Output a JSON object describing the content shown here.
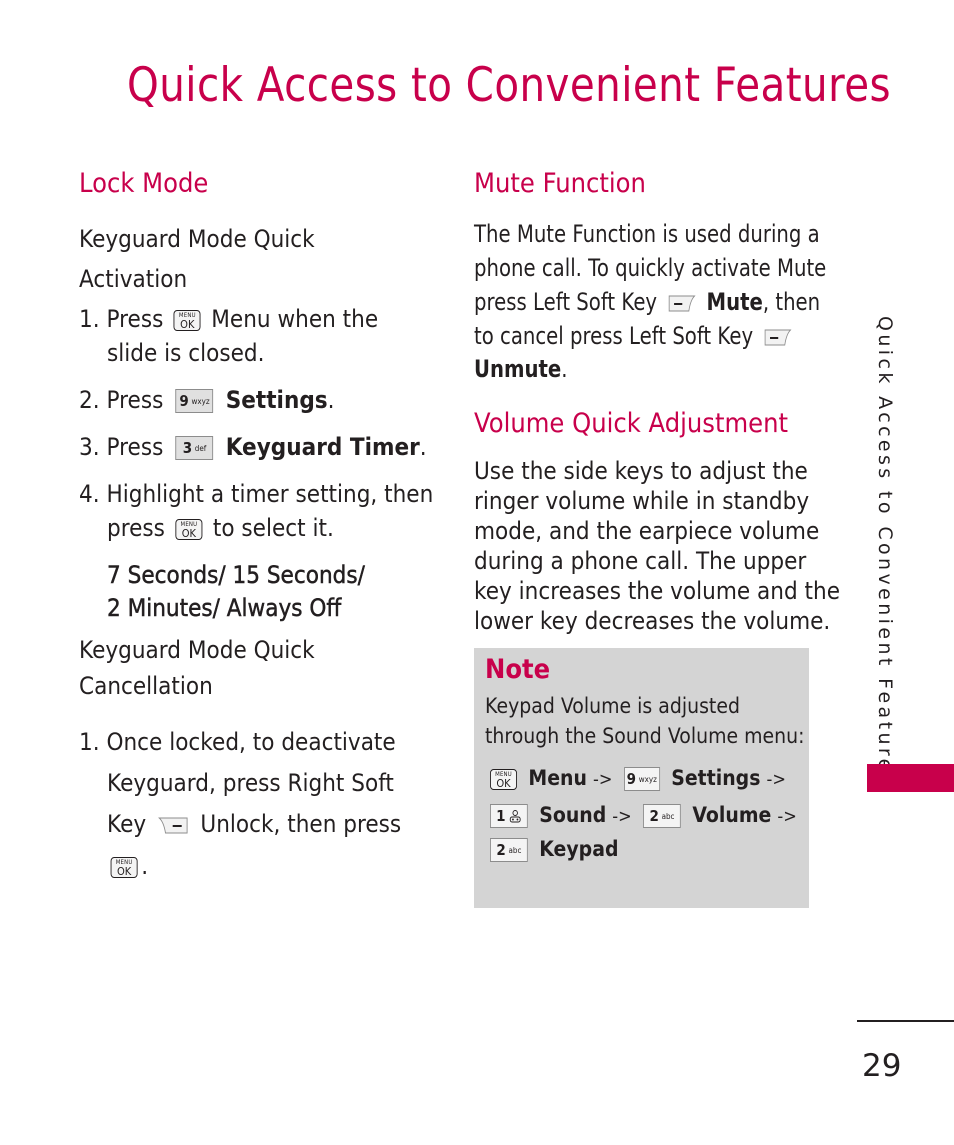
{
  "page": {
    "title": "Quick Access to Convenient Features",
    "side_tab": "Quick Access to Convenient Features",
    "page_number": "29",
    "accent_color": "#c8004b"
  },
  "lock_mode": {
    "heading": "Lock Mode",
    "activation": {
      "heading_line1": "Keyguard Mode Quick",
      "heading_line2": "Activation",
      "steps": [
        {
          "num": "1.",
          "pre": "Press",
          "key": "menu-ok-key",
          "post": "Menu when the",
          "cont": "slide is closed."
        },
        {
          "num": "2.",
          "pre": "Press",
          "key": "9 wxyz",
          "key_num": "9",
          "key_letters": "wxyz",
          "post": "Settings",
          "post_tail": "."
        },
        {
          "num": "3.",
          "pre": "Press",
          "key": "3 def",
          "key_num": "3",
          "key_letters": "def",
          "post": "Keyguard Timer",
          "post_tail": "."
        },
        {
          "num": "4.",
          "line1": "Highlight a timer setting, then",
          "pre": "press",
          "key": "menu-ok-key",
          "post": "to select it."
        }
      ],
      "options_line1": "7 Seconds/ 15 Seconds/",
      "options_line2": "2 Minutes/ Always Off"
    },
    "cancellation": {
      "heading_line1": "Keyguard Mode Quick",
      "heading_line2": "Cancellation",
      "steps": [
        {
          "num": "1.",
          "line1": "Once locked, to deactivate",
          "line2": "Keyguard, press Right Soft",
          "line3_pre": "Key",
          "line3_post": "Unlock, then press",
          "line4_tail": "."
        }
      ]
    }
  },
  "mute_function": {
    "heading": "Mute Function",
    "line1": "The Mute Function is used during a",
    "line2": "phone call. To quickly activate Mute",
    "line3_pre": "press Left Soft Key",
    "line3_bold": "Mute",
    "line3_post": ", then",
    "line4_pre": "to cancel press Left Soft Key",
    "line5_bold": "Unmute",
    "line5_post": "."
  },
  "volume_quick_adjustment": {
    "heading": "Volume Quick Adjustment",
    "lines": [
      "Use the side keys to adjust the",
      "ringer volume while in standby",
      "mode, and the earpiece volume",
      "during a phone call. The upper",
      "key increases the volume and the",
      "lower key decreases the volume."
    ]
  },
  "note": {
    "title": "Note",
    "line1": "Keypad Volume is adjusted",
    "line2": "through the Sound Volume menu:",
    "path": [
      {
        "key_num": "",
        "key_letters": "",
        "label": "Menu",
        "arrow": "->"
      },
      {
        "key_num": "9",
        "key_letters": "wxyz",
        "label": "Settings",
        "arrow": "->"
      },
      {
        "key_num": "1",
        "key_letters": "voicemail",
        "label": "Sound",
        "arrow": "->"
      },
      {
        "key_num": "2",
        "key_letters": "abc",
        "label": "Volume",
        "arrow": "->"
      },
      {
        "key_num": "2",
        "key_letters": "abc",
        "label": "Keypad",
        "arrow": ""
      }
    ]
  },
  "keys": {
    "menu_top": "MENU",
    "menu_bottom": "OK"
  }
}
